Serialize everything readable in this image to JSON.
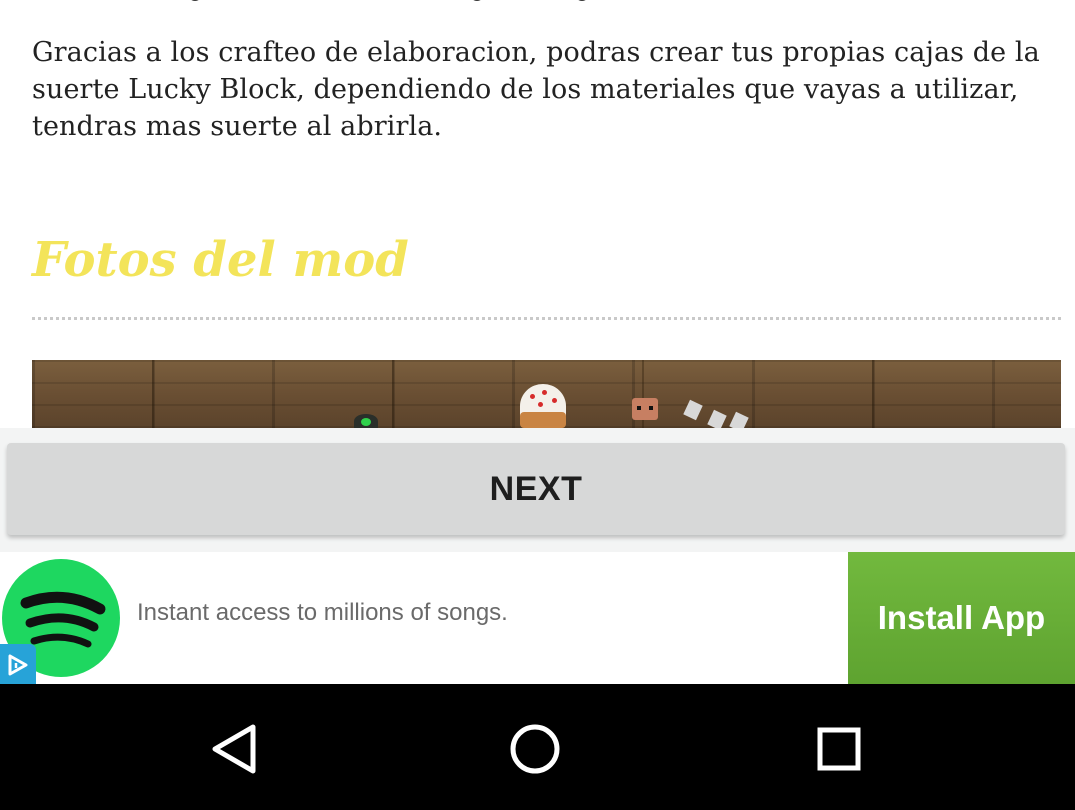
{
  "article": {
    "body_text": "Gracias a los crafteo de elaboracion, podras crear tus propias cajas de la suerte Lucky Block, dependiendo de los materiales que vayas a utilizar, tendras mas suerte al abrirla.",
    "section_heading": "Fotos del mod",
    "heading_color": "#f3e45a"
  },
  "next_button": {
    "label": "NEXT"
  },
  "ad": {
    "brand_icon": "spotify-icon",
    "text": "Instant access to millions of songs.",
    "cta_label": "Install App",
    "cta_color": "#67ae36",
    "adchoices_icon": "adchoices-icon"
  },
  "nav_bar": {
    "buttons": [
      "back-icon",
      "home-icon",
      "recents-icon"
    ]
  }
}
